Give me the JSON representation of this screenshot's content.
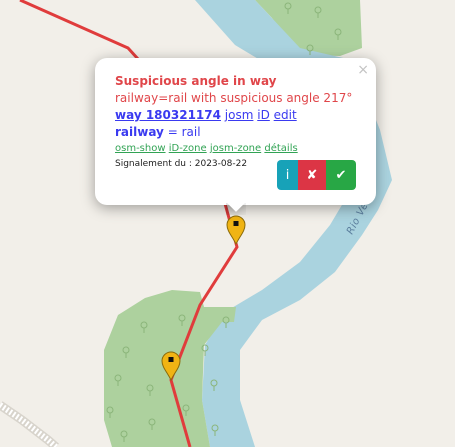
{
  "map": {
    "river_label": "Rio Ve",
    "colors": {
      "land": "#f2efe9",
      "water": "#aad3df",
      "forest": "#add19e",
      "railway_line": "#e03c3c",
      "marker": "#f0b414"
    },
    "markers": [
      {
        "name": "marker-selected"
      },
      {
        "name": "marker-other"
      }
    ]
  },
  "popup": {
    "close_symbol": "×",
    "title": "Suspicious angle in way",
    "subtitle": "railway=rail with suspicious angle 217°",
    "way_link": "way 180321174",
    "editor_links": [
      "josm",
      "iD",
      "edit"
    ],
    "tag": {
      "key": "railway",
      "eq": " = ",
      "value": "rail"
    },
    "small_links": [
      "osm-show",
      "iD-zone",
      "josm-zone",
      "détails"
    ],
    "report": "Signalement du : 2023-08-22",
    "buttons": {
      "info": "i",
      "false_positive": "✘",
      "fixed": "✔"
    }
  }
}
